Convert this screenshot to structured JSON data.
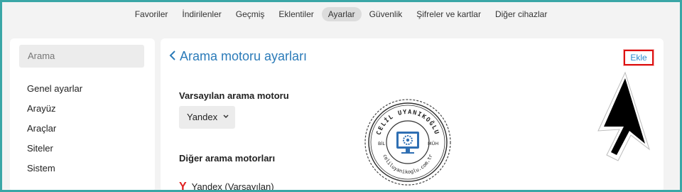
{
  "topnav": {
    "items": [
      {
        "label": "Favoriler"
      },
      {
        "label": "İndirilenler"
      },
      {
        "label": "Geçmiş"
      },
      {
        "label": "Eklentiler"
      },
      {
        "label": "Ayarlar"
      },
      {
        "label": "Güvenlik"
      },
      {
        "label": "Şifreler ve kartlar"
      },
      {
        "label": "Diğer cihazlar"
      }
    ],
    "active": "Ayarlar"
  },
  "sidebar": {
    "search_placeholder": "Arama",
    "items": [
      {
        "label": "Genel ayarlar"
      },
      {
        "label": "Arayüz"
      },
      {
        "label": "Araçlar"
      },
      {
        "label": "Siteler"
      },
      {
        "label": "Sistem"
      }
    ]
  },
  "main": {
    "title": "Arama motoru ayarları",
    "add_label": "Ekle",
    "default_engine_label": "Varsayılan arama motoru",
    "default_engine_value": "Yandex",
    "other_engines_label": "Diğer arama motorları",
    "engines": [
      {
        "icon": "Y",
        "label": "Yandex (Varsayılan)"
      }
    ]
  },
  "watermark": {
    "name": "CELİL UYANIKOĞLU",
    "left": "BİL",
    "right": "MÜH",
    "site": "celiluyanikoglu.com.tr"
  },
  "colors": {
    "frame": "#3aa6a6",
    "accent": "#2b7bb9",
    "highlight": "#dd1111",
    "yandex": "#e02020"
  }
}
